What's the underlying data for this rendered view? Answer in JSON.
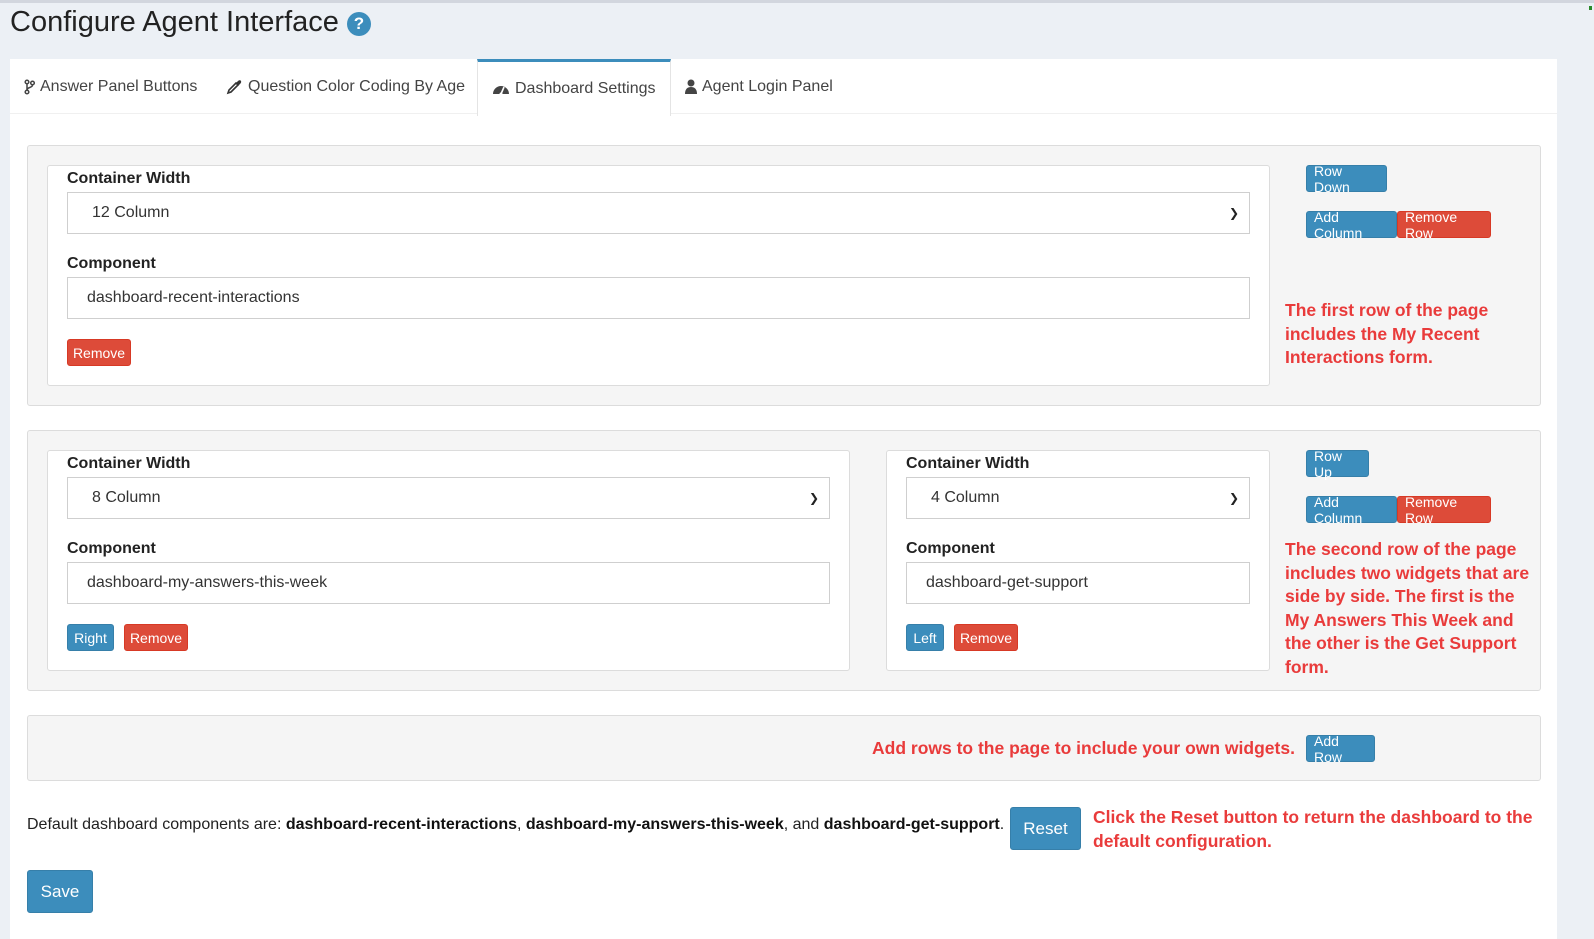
{
  "page": {
    "title": "Configure Agent Interface",
    "help_icon": "question-circle-icon"
  },
  "tabs": [
    {
      "label": "Answer Panel Buttons",
      "icon": "code-branch-icon",
      "active": false
    },
    {
      "label": "Question Color Coding By Age",
      "icon": "eyedropper-icon",
      "active": false
    },
    {
      "label": "Dashboard Settings",
      "icon": "tachometer-icon",
      "active": true
    },
    {
      "label": "Agent Login Panel",
      "icon": "user-icon",
      "active": false
    }
  ],
  "labels": {
    "container_width": "Container Width",
    "component": "Component"
  },
  "rows": [
    {
      "columns": [
        {
          "width": "12 Column",
          "component": "dashboard-recent-interactions",
          "buttons": [
            "Remove"
          ]
        }
      ],
      "row_buttons": [
        "Row Down",
        "Add Column",
        "Remove Row"
      ],
      "note": "The first row of the page includes the My Recent Interactions form."
    },
    {
      "columns": [
        {
          "width": "8 Column",
          "component": "dashboard-my-answers-this-week",
          "buttons": [
            "Right",
            "Remove"
          ]
        },
        {
          "width": "4 Column",
          "component": "dashboard-get-support",
          "buttons": [
            "Left",
            "Remove"
          ]
        }
      ],
      "row_buttons": [
        "Row Up",
        "Add Column",
        "Remove Row"
      ],
      "note": "The second row of the page includes two widgets that are side by side. The first is the My Answers This Week and the other is the Get Support form."
    }
  ],
  "add_row": {
    "note": "Add rows to the page to include your own widgets.",
    "button": "Add Row"
  },
  "defaults": {
    "prefix": "Default dashboard components are: ",
    "c1": "dashboard-recent-interactions",
    "sep1": ", ",
    "c2": "dashboard-my-answers-this-week",
    "sep2": ", and ",
    "c3": "dashboard-get-support",
    "suffix": ".",
    "reset_button": "Reset",
    "reset_note": "Click the Reset button to return the dashboard to the default configuration."
  },
  "save_button": "Save",
  "colors": {
    "primary": "#3c8dbc",
    "danger": "#dd4b39",
    "annotation": "#e93b3b"
  }
}
